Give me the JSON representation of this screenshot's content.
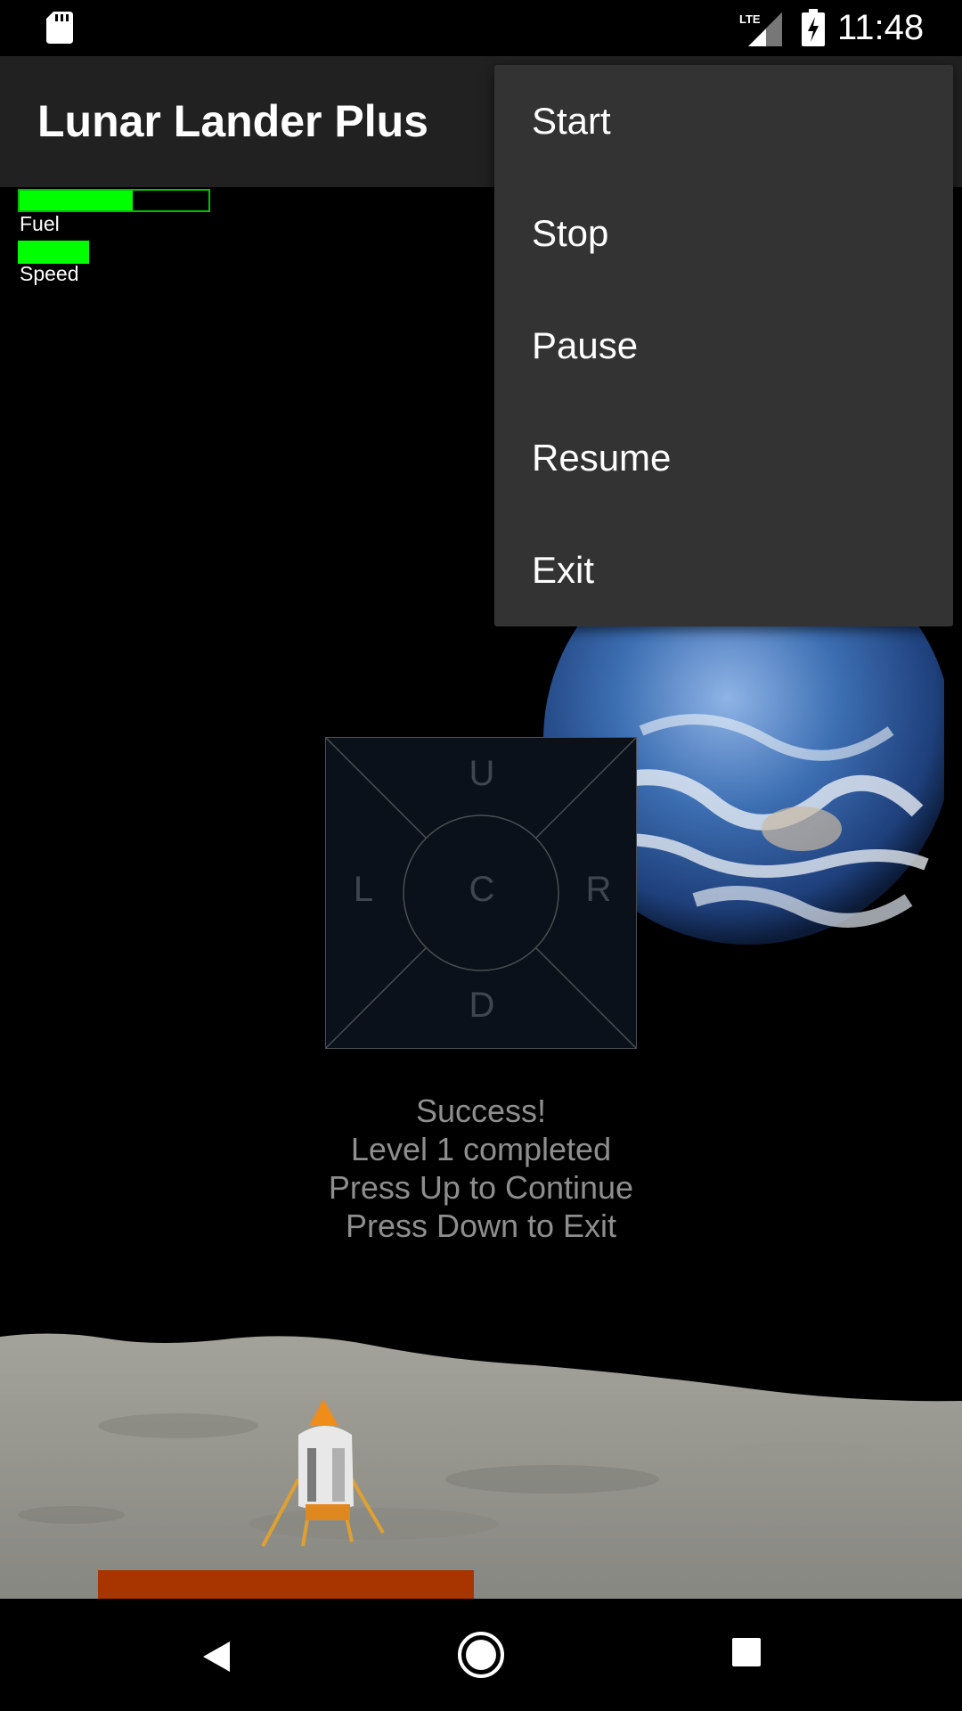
{
  "status_bar": {
    "time": "11:48",
    "network": "LTE",
    "icons": [
      "sd-card-icon",
      "lte-signal-icon",
      "battery-charging-icon"
    ]
  },
  "app_bar": {
    "title": "Lunar Lander Plus"
  },
  "hud": {
    "fuel_label": "Fuel",
    "fuel_level": 0.6,
    "speed_label": "Speed",
    "speed_level": 0.37
  },
  "dpad": {
    "up": "U",
    "left": "L",
    "center": "C",
    "right": "R",
    "down": "D"
  },
  "message": {
    "line1": "Success!",
    "line2": "Level 1 completed",
    "line3": "Press Up to Continue",
    "line4": "Press Down to Exit"
  },
  "menu": {
    "items": [
      {
        "label": "Start"
      },
      {
        "label": "Stop"
      },
      {
        "label": "Pause"
      },
      {
        "label": "Resume"
      },
      {
        "label": "Exit"
      }
    ]
  },
  "nav_bar": {
    "icons": [
      "back-icon",
      "home-icon",
      "recents-icon"
    ]
  },
  "colors": {
    "hud_green": "#00ff00",
    "landing_pad": "#a83500",
    "menu_bg": "#333333",
    "app_bar_bg": "#212121"
  }
}
